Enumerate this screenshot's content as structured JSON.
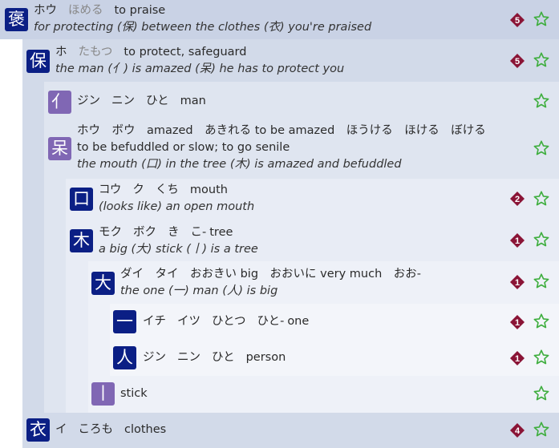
{
  "colors": {
    "kanji_dark": "#0b1f85",
    "kanji_light": "#8067b4",
    "badge": "#8a1436",
    "star": "#3fae3f"
  },
  "rows": [
    {
      "kanji": "褒",
      "badge": "5",
      "kana": [
        "ホウ",
        "ほめる"
      ],
      "meaning": "to praise",
      "description": "for protecting (保) between the clothes (衣) you're praised"
    },
    {
      "kanji": "保",
      "badge": "5",
      "kana": [
        "ホ",
        "たもつ"
      ],
      "meaning": "to protect, safeguard",
      "description": "the man (亻) is amazed (呆) he has to protect you"
    },
    {
      "kanji": "亻",
      "badge": "",
      "kana": [
        "ジン",
        "ニン",
        "ひと"
      ],
      "meaning": "man",
      "description": ""
    },
    {
      "kanji": "呆",
      "badge": "",
      "readings_line": "ホウ　ボウ　amazed　あきれる to be amazed　ほうける　ほける　ぼける",
      "meaning_line": "to be befuddled or slow; to go senile",
      "description": "the mouth (口) in the tree (木) is amazed and befuddled"
    },
    {
      "kanji": "口",
      "badge": "2",
      "kana": [
        "コウ",
        "ク",
        "くち"
      ],
      "meaning": "mouth",
      "description": "(looks like) an open mouth"
    },
    {
      "kanji": "木",
      "badge": "1",
      "kana": [
        "モク",
        "ボク",
        "き",
        "こ-"
      ],
      "meaning": "tree",
      "description": "a big (大) stick (丨) is a tree"
    },
    {
      "kanji": "大",
      "badge": "1",
      "readings_line": "ダイ　タイ　おおきい big　おおいに very much　おお-",
      "description": "the one (一) man (人) is big"
    },
    {
      "kanji": "一",
      "badge": "1",
      "kana": [
        "イチ",
        "イツ",
        "ひとつ",
        "ひと-"
      ],
      "meaning": "one",
      "description": ""
    },
    {
      "kanji": "人",
      "badge": "1",
      "kana": [
        "ジン",
        "ニン",
        "ひと"
      ],
      "meaning": "person",
      "description": ""
    },
    {
      "kanji": "丨",
      "badge": "",
      "kana": [],
      "meaning": "stick",
      "description": ""
    },
    {
      "kanji": "衣",
      "badge": "4",
      "kana": [
        "イ",
        "ころも"
      ],
      "meaning": "clothes",
      "description": ""
    }
  ]
}
